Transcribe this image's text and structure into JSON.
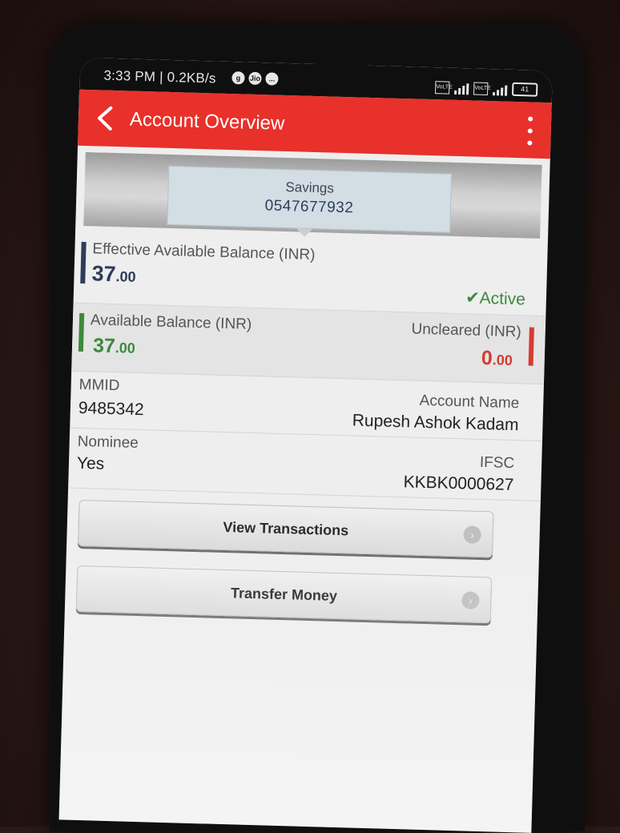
{
  "statusbar": {
    "time_speed": "3:33 PM | 0.2KB/s",
    "icons": [
      "g",
      "Jio",
      "..."
    ],
    "network": "4G",
    "battery": "41"
  },
  "appbar": {
    "title": "Account Overview",
    "back_icon": "chevron-left-icon",
    "menu_icon": "more-vertical-icon"
  },
  "account_card": {
    "type": "Savings",
    "number": "0547677932"
  },
  "balances": {
    "effective_label": "Effective Available Balance (INR)",
    "effective_main": "37",
    "effective_decimal": ".00",
    "status": "Active",
    "available_label": "Available Balance (INR)",
    "available_main": "37",
    "available_decimal": ".00",
    "uncleared_label": "Uncleared (INR)",
    "uncleared_main": "0",
    "uncleared_decimal": ".00"
  },
  "details": {
    "mmid_label": "MMID",
    "mmid_value": "9485342",
    "account_name_label": "Account Name",
    "account_name_value": "Rupesh Ashok Kadam",
    "nominee_label": "Nominee",
    "nominee_value": "Yes",
    "ifsc_label": "IFSC",
    "ifsc_value": "KKBK0000627"
  },
  "actions": {
    "view_transactions": "View Transactions",
    "transfer_money": "Transfer Money"
  },
  "colors": {
    "brand_red": "#e8312a",
    "navy": "#2d3c5a",
    "green": "#3b8a3b",
    "red": "#d63a35"
  }
}
